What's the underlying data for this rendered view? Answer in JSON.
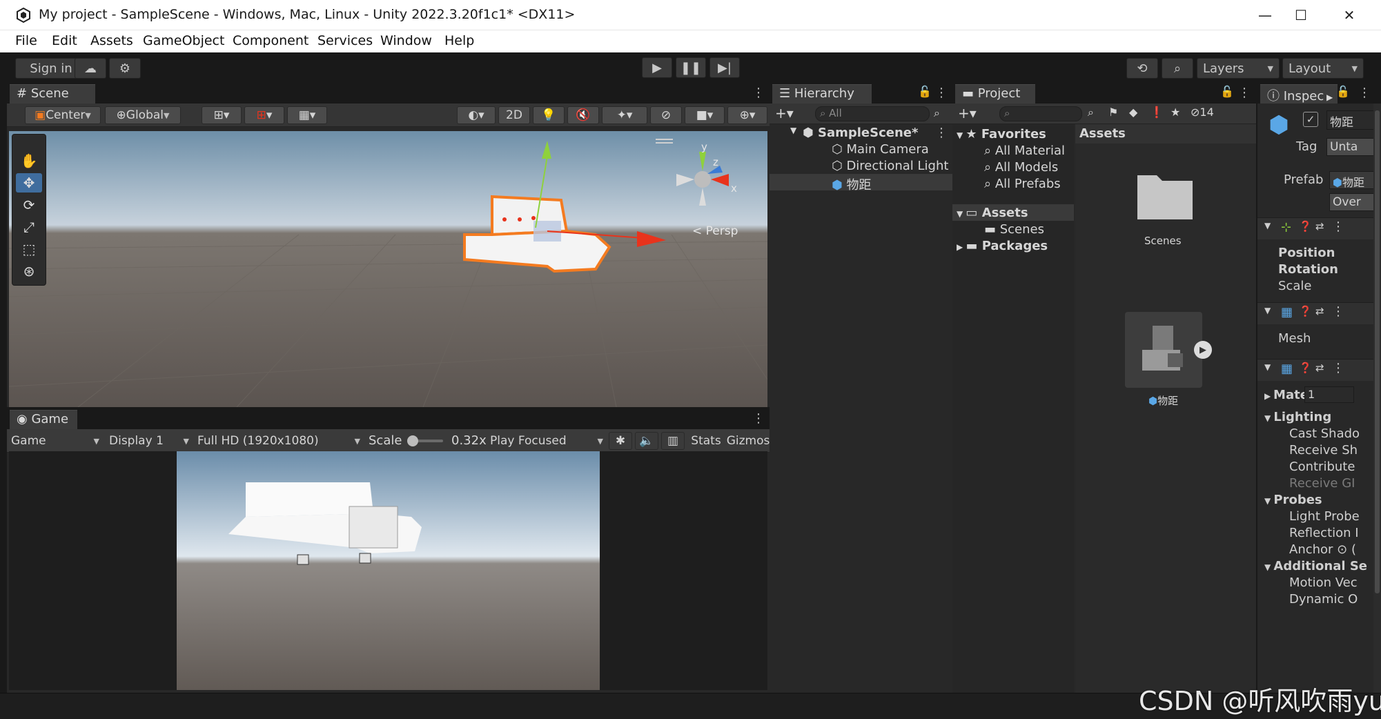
{
  "window": {
    "title": "My project - SampleScene - Windows, Mac, Linux - Unity 2022.3.20f1c1* <DX11>",
    "controls": {
      "minimize": "—",
      "maximize": "☐",
      "close": "✕"
    }
  },
  "menu": [
    "File",
    "Edit",
    "Assets",
    "GameObject",
    "Component",
    "Services",
    "Window",
    "Help"
  ],
  "toolbar": {
    "sign_in": "Sign in",
    "layers": "Layers",
    "layout": "Layout"
  },
  "scene": {
    "tab": "Scene",
    "pivot": "Center",
    "space": "Global",
    "mode_2d": "2D",
    "persp_label": "Persp",
    "gizmo_axes": {
      "y": "y",
      "x": "x",
      "z": "z"
    }
  },
  "game": {
    "tab": "Game",
    "view_dropdown": "Game",
    "display": "Display 1",
    "resolution": "Full HD (1920x1080)",
    "scale_label": "Scale",
    "scale_value": "0.32x",
    "play_mode": "Play Focused",
    "stats": "Stats",
    "gizmos": "Gizmos"
  },
  "hierarchy": {
    "tab": "Hierarchy",
    "search_placeholder": "All",
    "scene_name": "SampleScene*",
    "items": [
      "Main Camera",
      "Directional Light",
      "物距"
    ]
  },
  "project": {
    "tab": "Project",
    "hidden_count": "14",
    "favorites": "Favorites",
    "favorite_items": [
      "All Material",
      "All Models",
      "All Prefabs"
    ],
    "assets_root": "Assets",
    "scenes_folder": "Scenes",
    "packages": "Packages",
    "breadcrumb": "Assets",
    "grid_items": [
      "Scenes",
      "物距"
    ]
  },
  "inspector": {
    "tab": "Inspec",
    "object_name": "物距",
    "tag_label": "Tag",
    "tag_value": "Unta",
    "prefab_label": "Prefab",
    "prefab_value": "物距",
    "overrides": "Over",
    "transform_rows": [
      "Position",
      "Rotation",
      "Scale"
    ],
    "mesh_label": "Mesh",
    "material_label": "Mate",
    "material_count": "1",
    "lighting_header": "Lighting",
    "lighting_rows": [
      "Cast Shado",
      "Receive Sh",
      "Contribute",
      "Receive GI"
    ],
    "probes_header": "Probes",
    "probes_rows": [
      "Light Probe",
      "Reflection I",
      "Anchor ⊙ ("
    ],
    "additional_header": "Additional Se",
    "additional_rows": [
      "Motion Vec",
      "Dynamic O"
    ]
  },
  "watermark": "CSDN @听风吹雨yu",
  "colors": {
    "selection_orange": "#f47b20",
    "axis_x_red": "#e8331c",
    "axis_y_green": "#8fd13c",
    "axis_z_blue": "#3a7bd5",
    "panel_bg": "#282828",
    "sky": "#9fb4c6"
  }
}
